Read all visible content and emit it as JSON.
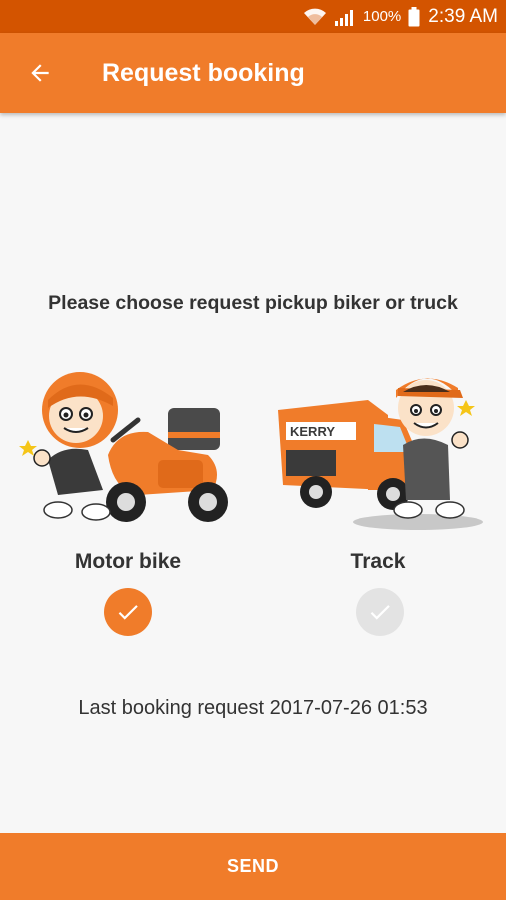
{
  "status_bar": {
    "battery_percent": "100%",
    "time": "2:39 AM",
    "icons": [
      "wifi-icon",
      "signal-icon",
      "battery-icon"
    ]
  },
  "app_bar": {
    "title": "Request booking",
    "back_icon": "arrow-back-icon"
  },
  "prompt": "Please choose request pickup biker or truck",
  "options": [
    {
      "label": "Motor bike",
      "selected": true,
      "illustration": "motorbike-courier"
    },
    {
      "label": "Track",
      "selected": false,
      "illustration": "pickup-truck-courier"
    }
  ],
  "truck_branding": "KERRY",
  "last_request": "Last booking request 2017-07-26 01:53",
  "send_label": "SEND",
  "colors": {
    "primary": "#f07c2a",
    "status_bar": "#d35400",
    "background": "#f7f7f7",
    "unselected": "#e3e3e3",
    "text": "#333333"
  }
}
